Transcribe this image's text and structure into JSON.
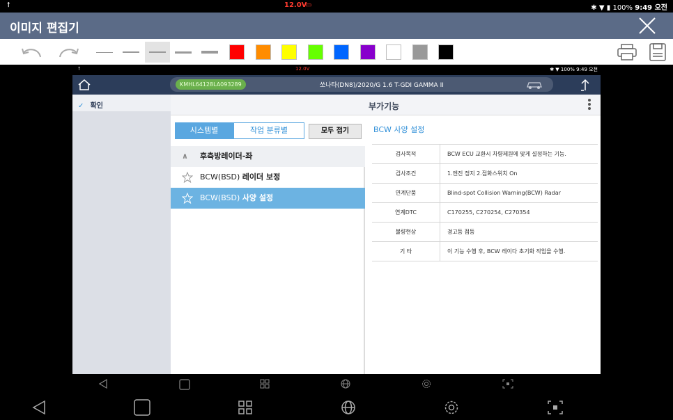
{
  "outer_status": {
    "upload_icon": "upload-icon",
    "voltage": "12.0V",
    "battery_percent": "100%",
    "time": "9:49 오전"
  },
  "editor": {
    "title": "이미지 편집기"
  },
  "toolbar": {
    "colors": [
      "#ff0000",
      "#ff8c00",
      "#ffff00",
      "#66ff00",
      "#0066ff",
      "#8800cc",
      "#ffffff",
      "#999999",
      "#000000"
    ],
    "selected_line": 2
  },
  "inner_status": {
    "voltage": "12.0V",
    "battery_percent": "100%",
    "time": "9:49 오전"
  },
  "inner_header": {
    "vin": "KMHL64128LA093289",
    "model": "쏘나타(DN8)/2020/G 1.6 T-GDI GAMMA II"
  },
  "sidebar": {
    "confirm_label": "확인"
  },
  "content": {
    "title": "부가기능",
    "tabs": {
      "system": "시스템별",
      "category": "작업 분류별",
      "collapse": "모두 접기"
    },
    "group_label": "후측방레이더-좌",
    "items": [
      {
        "label_a": "BCW(BSD) ",
        "label_b": "레이더 보정"
      },
      {
        "label_a": "BCW(BSD) ",
        "label_b": "사양 설정"
      }
    ],
    "detail_title": "BCW 사양 설정",
    "specs": [
      {
        "key": "검사목적",
        "value": "BCW ECU 교환시 차량제원에 맞게 설정하는 기능."
      },
      {
        "key": "검사조건",
        "value": "1.엔진 정지 2.점화스위치 On"
      },
      {
        "key": "연계단품",
        "value": "Blind-spot Collision Warning(BCW) Radar"
      },
      {
        "key": "연계DTC",
        "value": "C170255, C270254, C270354"
      },
      {
        "key": "불량현상",
        "value": "경고등 점등"
      },
      {
        "key": "기 타",
        "value": "이 기능 수행 후, BCW 레이다 초기화 작업을 수행."
      }
    ]
  }
}
